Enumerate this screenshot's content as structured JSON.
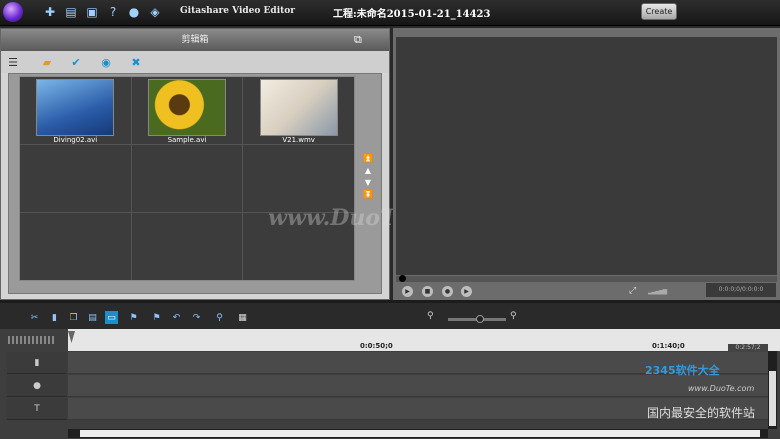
{
  "window": {
    "app_title": "Gitashare Video Editor",
    "project_title": "工程:未命名2015-01-21_14423",
    "create_label": "Create"
  },
  "toolbar": {
    "icons": [
      "new-project-icon",
      "open-icon",
      "save-icon",
      "help-icon",
      "chat-icon",
      "share-icon"
    ]
  },
  "library": {
    "header": "剪辑箱",
    "items": [
      {
        "name": "Diving02.avi"
      },
      {
        "name": "Sample.avi"
      },
      {
        "name": "V21.wmv"
      }
    ]
  },
  "preview": {
    "time": "0:0:0;0/0:0:0:0"
  },
  "timeline": {
    "ruler": [
      "0:0:50;0",
      "0:1:40;0"
    ],
    "current_time": "0:2:57;2"
  },
  "watermark": "www.DuoTe.com",
  "badge": {
    "logo": "2345软件大全",
    "site": "www.DuoTe.com",
    "text": "国内最安全的软件站"
  }
}
